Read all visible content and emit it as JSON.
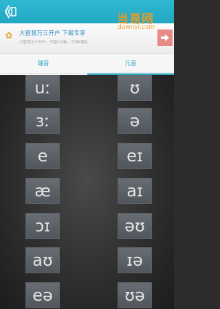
{
  "appbar": {
    "back_icon": "back-arrow-icon",
    "color": "#2aa9c4"
  },
  "ad": {
    "title": "大智慧万三开户 下载专享",
    "subtitle": "大智慧万三开户，只需5分钟，可领6毫礼",
    "arrow_icon": "arrow-right-icon"
  },
  "watermark": {
    "top": "当易网",
    "bottom": "downyi.com"
  },
  "tabs": [
    {
      "label": "辅音",
      "active": false
    },
    {
      "label": "元音",
      "active": true
    }
  ],
  "phonemes": {
    "left": [
      "uː",
      "ɜː",
      "e",
      "æ",
      "ɔɪ",
      "aʊ",
      "eə"
    ],
    "right": [
      "ʊ",
      "ə",
      "eɪ",
      "aɪ",
      "əʊ",
      "ɪə",
      "ʊə"
    ]
  }
}
